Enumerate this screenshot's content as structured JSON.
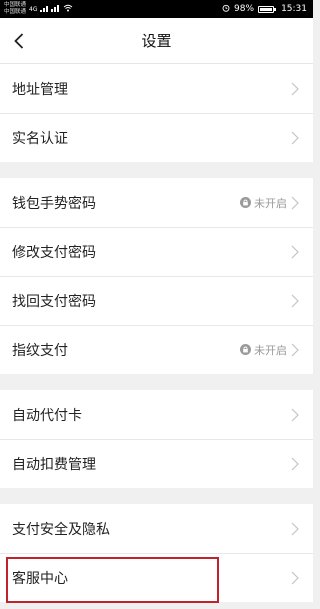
{
  "status_bar": {
    "carrier1": "中国联通",
    "carrier2": "中国联通",
    "network": "4G",
    "battery": "98%",
    "time": "15:31"
  },
  "nav": {
    "title": "设置"
  },
  "groups": [
    {
      "items": [
        {
          "label": "地址管理"
        },
        {
          "label": "实名认证"
        }
      ]
    },
    {
      "items": [
        {
          "label": "钱包手势密码",
          "status": "未开启"
        },
        {
          "label": "修改支付密码"
        },
        {
          "label": "找回支付密码"
        },
        {
          "label": "指纹支付",
          "status": "未开启"
        }
      ]
    },
    {
      "items": [
        {
          "label": "自动代付卡"
        },
        {
          "label": "自动扣费管理"
        }
      ]
    },
    {
      "items": [
        {
          "label": "支付安全及隐私"
        },
        {
          "label": "客服中心"
        }
      ]
    }
  ],
  "colors": {
    "highlight": "#c0232b",
    "status_text": "#999999"
  }
}
